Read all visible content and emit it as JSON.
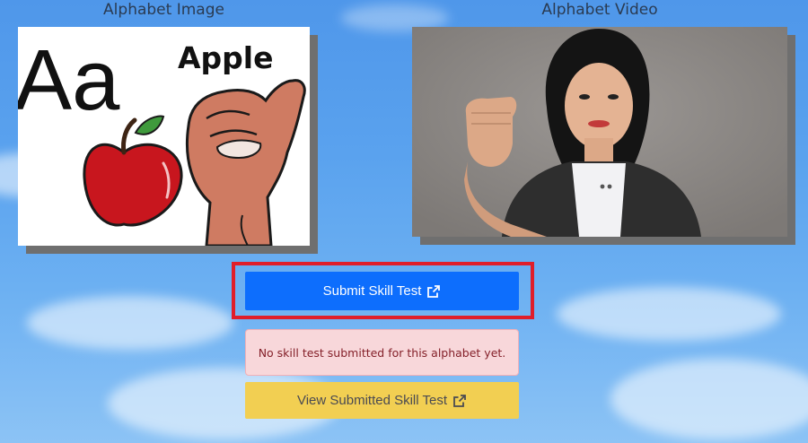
{
  "image_section": {
    "heading": "Alphabet Image",
    "letters": "Aa",
    "word": "Apple"
  },
  "video_section": {
    "heading": "Alphabet Video"
  },
  "actions": {
    "submit_label": "Submit Skill Test",
    "status_message": "No skill test submitted for this alphabet yet.",
    "view_label": "View Submitted Skill Test"
  },
  "icons": {
    "submit_icon": "external-link-icon",
    "view_icon": "external-link-icon"
  },
  "colors": {
    "primary": "#0d6efd",
    "warning": "#f2cf52",
    "alert_bg": "#f8d7da",
    "alert_text": "#842029",
    "highlight": "#e01e2a"
  }
}
